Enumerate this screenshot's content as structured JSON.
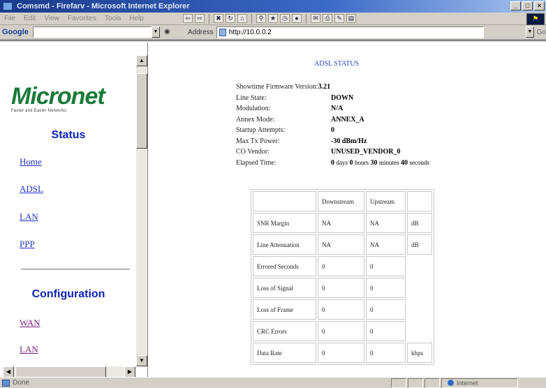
{
  "window": {
    "title": "Comsmd - Firefarv - Microsoft Internet Explorer",
    "controls": [
      "_",
      "□",
      "×"
    ]
  },
  "menu": [
    "File",
    "Edit",
    "View",
    "Favorites",
    "Tools",
    "Help"
  ],
  "toolbar": {
    "address_label": "Address",
    "url": "http://10.0.0.2",
    "go_label": "Go",
    "google_label": "Google"
  },
  "sidebar": {
    "brand": "Micronet",
    "tagline": "Faster and Easier Networks",
    "status_heading": "Status",
    "status_links": [
      "Home",
      "ADSL",
      "LAN",
      "PPP"
    ],
    "config_heading": "Configuration",
    "config_links": [
      "WAN",
      "LAN"
    ]
  },
  "adsl": {
    "title": "ADSL STATUS",
    "firmware_label": "Showtime Firmware Version:",
    "firmware_value": "3.21",
    "rows": [
      {
        "label": "Line State:",
        "value": "DOWN"
      },
      {
        "label": "Modulation:",
        "value": "N/A"
      },
      {
        "label": "Annex Mode:",
        "value": "ANNEX_A"
      },
      {
        "label": "Startup Attempts:",
        "value": "0"
      },
      {
        "label": "Max Tx Power:",
        "value": "-30 dBm/Hz"
      },
      {
        "label": "CO Vendor:",
        "value": "UNUSED_VENDOR_0"
      }
    ],
    "elapsed": {
      "label": "Elapsed Time:",
      "days": "0",
      "days_unit": "days",
      "hours": "0",
      "hours_unit": "hours",
      "minutes": "30",
      "minutes_unit": "minutes",
      "seconds": "40",
      "seconds_unit": "seconds"
    }
  },
  "stats": {
    "headers": [
      "Downstream",
      "Upstream"
    ],
    "rows": [
      {
        "label": "SNR Margin",
        "down": "NA",
        "up": "NA",
        "unit": "dB"
      },
      {
        "label": "Line Attenuation",
        "down": "NA",
        "up": "NA",
        "unit": "dB"
      },
      {
        "label": "Errored Seconds",
        "down": "0",
        "up": "0",
        "unit": ""
      },
      {
        "label": "Loss of Signal",
        "down": "0",
        "up": "0",
        "unit": ""
      },
      {
        "label": "Loss of Frame",
        "down": "0",
        "up": "0",
        "unit": ""
      },
      {
        "label": "CRC Errors",
        "down": "0",
        "up": "0",
        "unit": ""
      },
      {
        "label": "Data Rate",
        "down": "0",
        "up": "0",
        "unit": "kbps"
      }
    ]
  },
  "statusbar": {
    "text": "Done",
    "zone": "Internet"
  },
  "icons": {
    "back": "back-arrow-icon",
    "forward": "forward-arrow-icon",
    "stop": "stop-icon",
    "refresh": "refresh-icon",
    "home": "home-icon",
    "search": "search-icon",
    "favorites": "favorites-icon",
    "history": "history-icon",
    "mail": "mail-icon",
    "print": "print-icon"
  }
}
